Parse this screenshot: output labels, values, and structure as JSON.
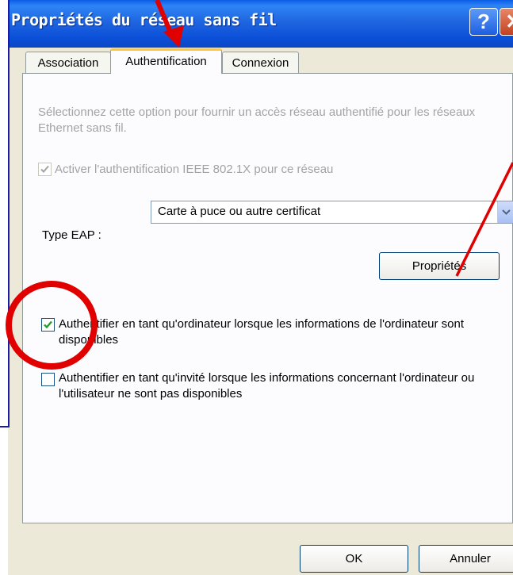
{
  "window": {
    "title": "Propriétés du réseau sans fil",
    "help_button": "?",
    "close_button": "✕"
  },
  "tabs": [
    {
      "label": "Association",
      "selected": false
    },
    {
      "label": "Authentification",
      "selected": true
    },
    {
      "label": "Connexion",
      "selected": false
    }
  ],
  "auth": {
    "description": "Sélectionnez cette option pour fournir un accès réseau authentifié pour les réseaux Ethernet sans fil.",
    "ieee_checkbox_label": "Activer l'authentification IEEE 802.1X pour ce réseau",
    "ieee_checked": true,
    "ieee_disabled": true,
    "eap_label": "Type EAP :",
    "eap_value": "Carte à puce ou autre certificat",
    "properties_button": "Propriétés",
    "computer_auth_label": "Authentifier en tant qu'ordinateur lorsque les informations de l'ordinateur sont disponibles",
    "computer_auth_checked": true,
    "guest_auth_label": "Authentifier en tant qu'invité lorsque les informations concernant l'ordinateur ou l'utilisateur ne sont pas disponibles",
    "guest_auth_checked": false
  },
  "buttons": {
    "ok": "OK",
    "cancel": "Annuler"
  },
  "colors": {
    "titlebar": "#0b4fd8",
    "annotation_red": "#e00000",
    "check_green": "#21a121"
  }
}
